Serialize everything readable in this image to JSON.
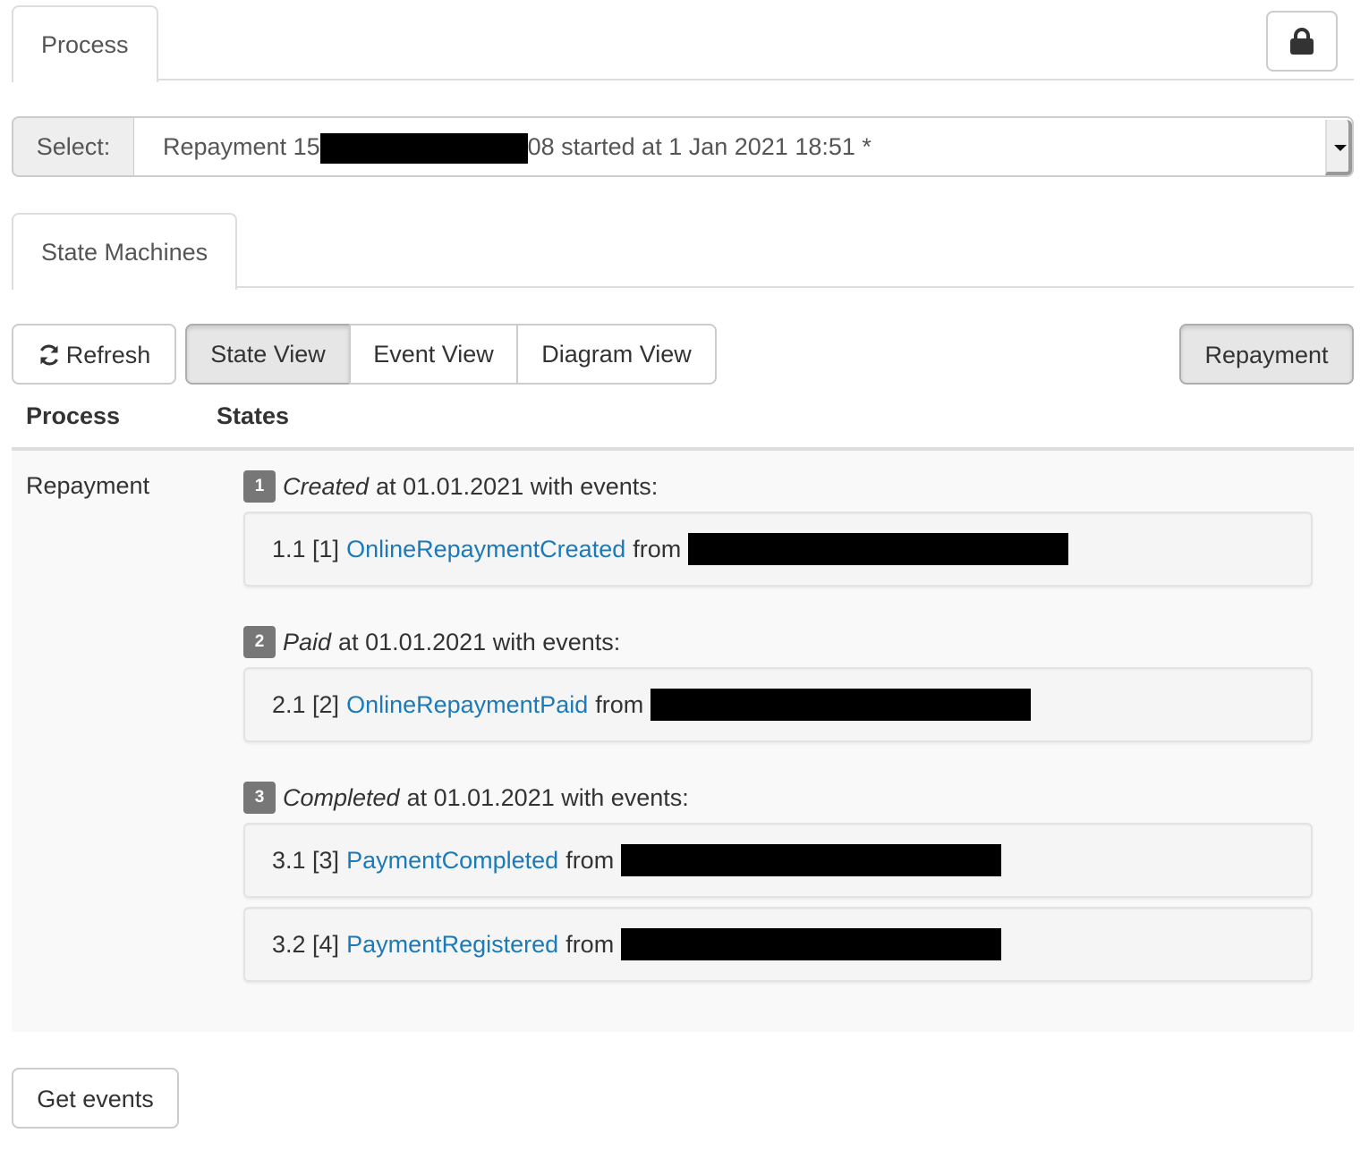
{
  "top_tabs": [
    {
      "label": "Process",
      "active": true
    }
  ],
  "lock_button": {
    "icon": "lock-icon"
  },
  "process_select": {
    "label": "Select:",
    "value_prefix": "Repayment 15",
    "value_suffix": "08 started at 1 Jan 2021 18:51 *",
    "redacted": true
  },
  "sub_tabs": [
    {
      "label": "State Machines",
      "active": true
    }
  ],
  "toolbar": {
    "refresh_label": "Refresh",
    "refresh_icon": "refresh-icon",
    "views": [
      {
        "label": "State View",
        "active": true
      },
      {
        "label": "Event View",
        "active": false
      },
      {
        "label": "Diagram View",
        "active": false
      }
    ],
    "process_filter_label": "Repayment"
  },
  "table": {
    "headers": {
      "process": "Process",
      "states": "States"
    },
    "rows": [
      {
        "process": "Repayment",
        "states": [
          {
            "number": "1",
            "name": "Created",
            "suffix": "at 01.01.2021 with events:",
            "events": [
              {
                "index": "1.1 [1]",
                "name": "OnlineRepaymentCreated",
                "from_label": "from",
                "source_redacted": true
              }
            ]
          },
          {
            "number": "2",
            "name": "Paid",
            "suffix": "at 01.01.2021 with events:",
            "events": [
              {
                "index": "2.1 [2]",
                "name": "OnlineRepaymentPaid",
                "from_label": "from",
                "source_redacted": true
              }
            ]
          },
          {
            "number": "3",
            "name": "Completed",
            "suffix": "at 01.01.2021 with events:",
            "events": [
              {
                "index": "3.1 [3]",
                "name": "PaymentCompleted",
                "from_label": "from",
                "source_redacted": true
              },
              {
                "index": "3.2 [4]",
                "name": "PaymentRegistered",
                "from_label": "from",
                "source_redacted": true
              }
            ]
          }
        ]
      }
    ]
  },
  "get_events_label": "Get events",
  "colors": {
    "link": "#1b7ab9",
    "badge": "#777777",
    "active_button": "#e6e6e6"
  }
}
